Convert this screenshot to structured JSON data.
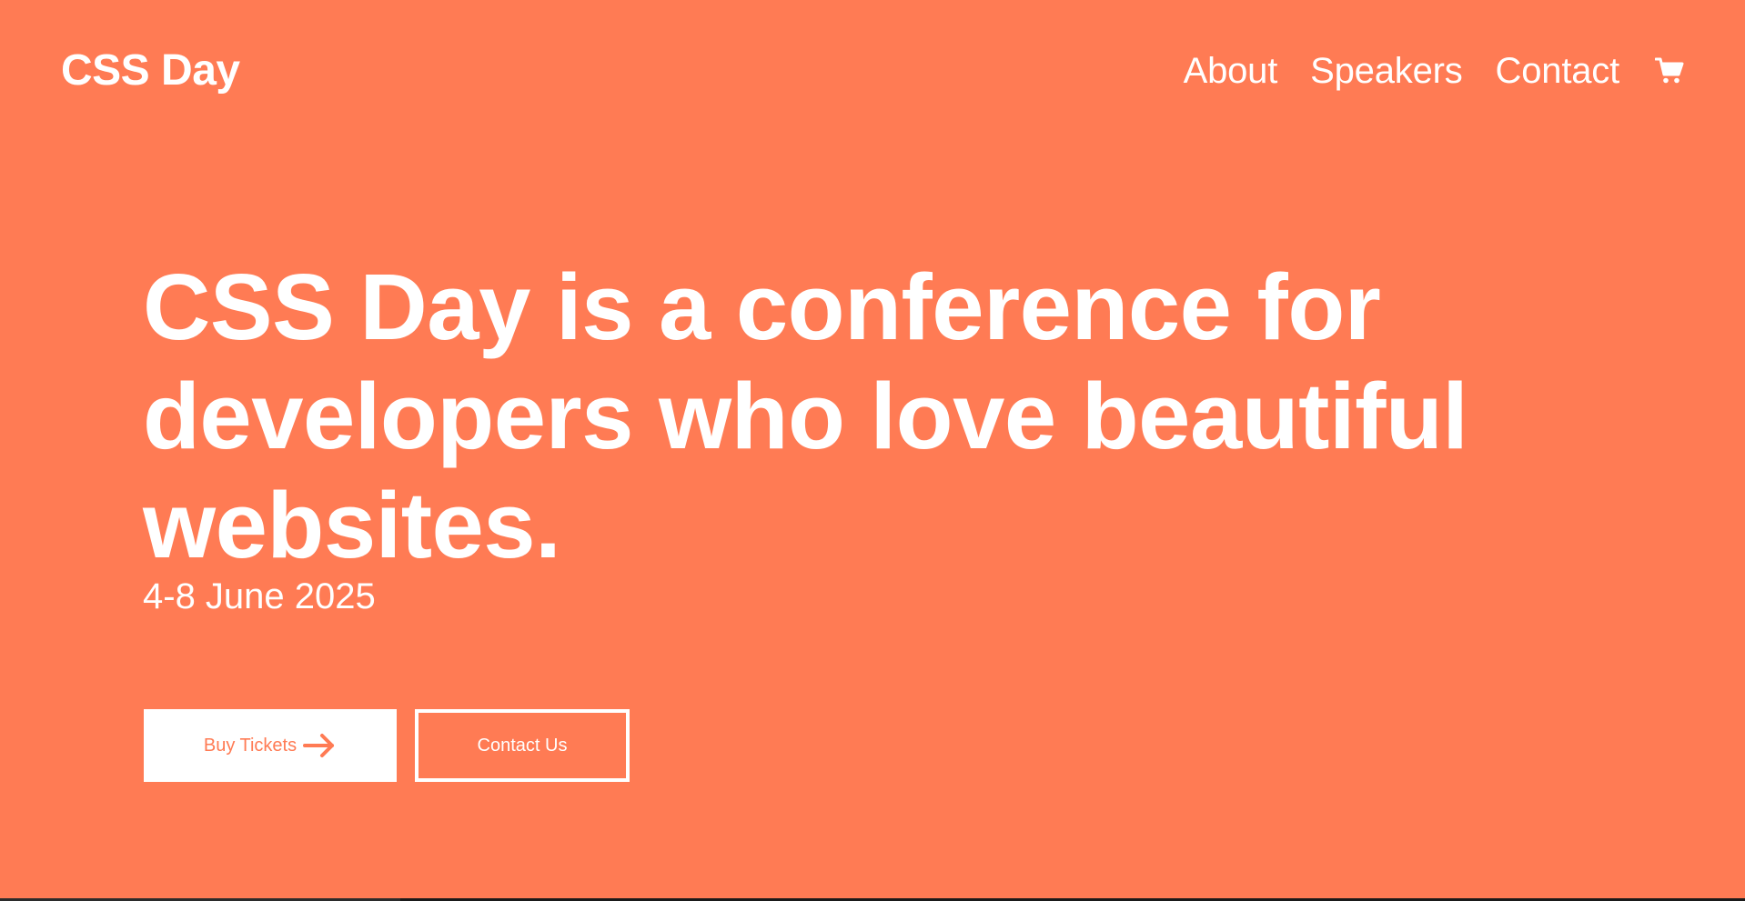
{
  "colors": {
    "background": "#ff7b54",
    "foreground": "#ffffff"
  },
  "header": {
    "logo": "CSS Day",
    "nav": [
      {
        "label": "About"
      },
      {
        "label": "Speakers"
      },
      {
        "label": "Contact"
      }
    ],
    "cart_icon": "shopping-cart-icon"
  },
  "hero": {
    "headline_lines": [
      "CSS Day is a conference for",
      "developers who love beautiful",
      "websites."
    ],
    "date": "4-8 June 2025"
  },
  "buttons": {
    "primary_label": "Buy Tickets",
    "primary_icon": "arrow-right-icon",
    "secondary_label": "Contact Us"
  }
}
